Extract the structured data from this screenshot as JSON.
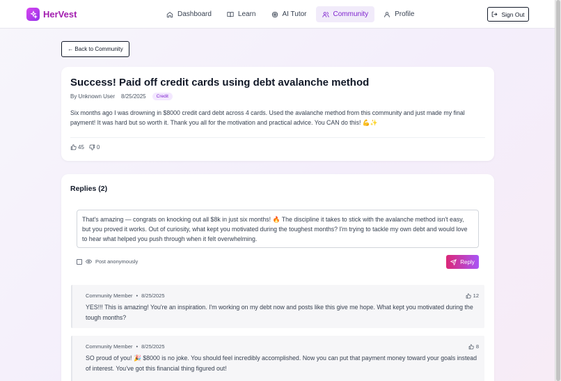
{
  "brand": {
    "name": "HerVest"
  },
  "nav": {
    "items": [
      {
        "label": "Dashboard",
        "icon": "home-icon"
      },
      {
        "label": "Learn",
        "icon": "book-icon"
      },
      {
        "label": "AI Tutor",
        "icon": "target-icon"
      },
      {
        "label": "Community",
        "icon": "users-icon",
        "active": true
      },
      {
        "label": "Profile",
        "icon": "user-icon"
      }
    ],
    "sign_out": "Sign Out"
  },
  "back_label": "← Back to Community",
  "post": {
    "title": "Success! Paid off credit cards using debt avalanche method",
    "author": "By Unknown User",
    "date": "8/25/2025",
    "tag": "Credit",
    "body": "Six months ago I was drowning in $8000 credit card debt across 4 cards. Used the avalanche method from this community and just made my final payment! It was hard but so worth it. Thank you all for the motivation and practical advice. You CAN do this! 💪✨",
    "likes": "45",
    "dislikes": "0"
  },
  "replies": {
    "title": "Replies (2)",
    "draft": "That's amazing — congrats on knocking out all $8k in just six months! 🔥 The discipline it takes to stick with the avalanche method isn't easy, but you proved it works. Out of curiosity, what kept you motivated during the toughest months? I'm trying to tackle my own debt and would love to hear what helped you push through when it felt overwhelming.",
    "anonymous_label": "Post anonymously",
    "reply_button": "Reply",
    "items": [
      {
        "author": "Community Member",
        "separator": "•",
        "date": "8/25/2025",
        "likes": "12",
        "text": "YES!!! This is amazing! You're an inspiration. I'm working on my debt now and posts like this give me hope. What kept you motivated during the tough months?"
      },
      {
        "author": "Community Member",
        "separator": "•",
        "date": "8/25/2025",
        "likes": "8",
        "text": "SO proud of you! 🎉 $8000 is no joke. You should feel incredibly accomplished. Now you can put that payment money toward your goals instead of interest. You've got this financial thing figured out!"
      }
    ]
  },
  "colors": {
    "brand": "#a21caf",
    "accent": "#7e22ce",
    "reply_gradient_start": "#db2777",
    "reply_gradient_end": "#a855f7"
  }
}
